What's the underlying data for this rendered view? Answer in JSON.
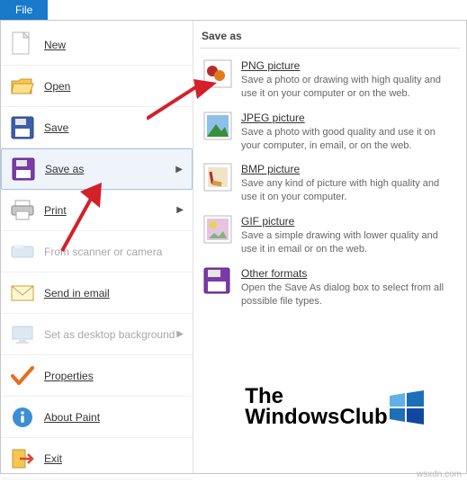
{
  "tab": {
    "label": "File"
  },
  "menu": {
    "new": {
      "label": "New"
    },
    "open": {
      "label": "Open"
    },
    "save": {
      "label": "Save"
    },
    "save_as": {
      "label": "Save as"
    },
    "print": {
      "label": "Print"
    },
    "scanner": {
      "label": "From scanner or camera"
    },
    "send_email": {
      "label": "Send in email"
    },
    "set_bg": {
      "label": "Set as desktop background"
    },
    "properties": {
      "label": "Properties"
    },
    "about": {
      "label": "About Paint"
    },
    "exit": {
      "label": "Exit"
    }
  },
  "right": {
    "title": "Save as",
    "formats": [
      {
        "title": "PNG picture",
        "desc": "Save a photo or drawing with high quality and use it on your computer or on the web."
      },
      {
        "title": "JPEG picture",
        "desc": "Save a photo with good quality and use it on your computer, in email, or on the web."
      },
      {
        "title": "BMP picture",
        "desc": "Save any kind of picture with high quality and use it on your computer."
      },
      {
        "title": "GIF picture",
        "desc": "Save a simple drawing with lower quality and use it in email or on the web."
      },
      {
        "title": "Other formats",
        "desc": "Open the Save As dialog box to select from all possible file types."
      }
    ]
  },
  "logo": {
    "line1": "The",
    "line2": "WindowsClub"
  },
  "watermark": "wsxdn.com"
}
